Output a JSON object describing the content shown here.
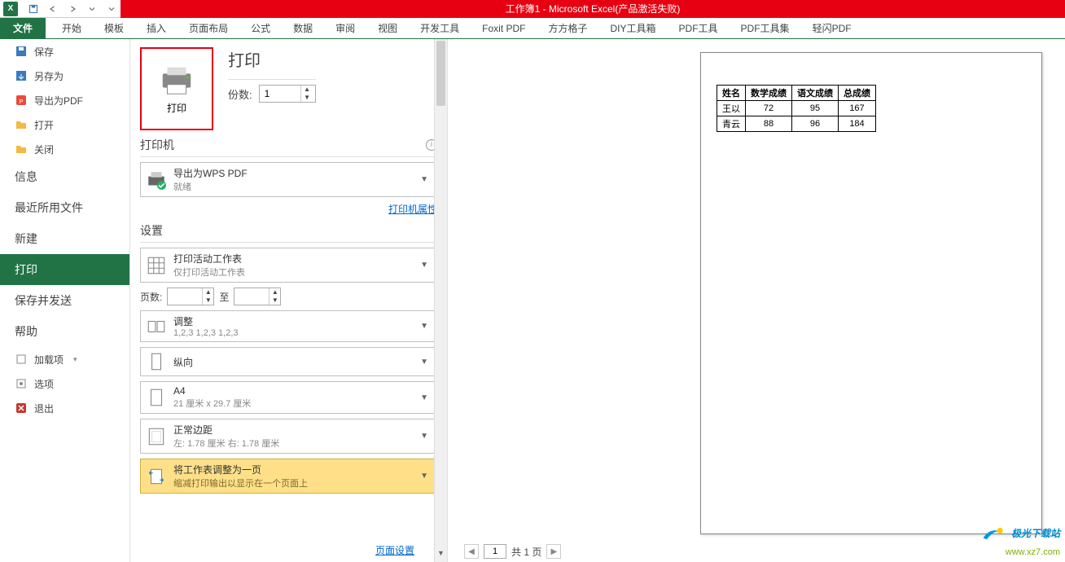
{
  "title": "工作簿1 - Microsoft Excel(产品激活失败)",
  "ribbon": {
    "file": "文件",
    "tabs": [
      "开始",
      "模板",
      "插入",
      "页面布局",
      "公式",
      "数据",
      "审阅",
      "视图",
      "开发工具",
      "Foxit PDF",
      "方方格子",
      "DIY工具箱",
      "PDF工具",
      "PDF工具集",
      "轻闪PDF"
    ]
  },
  "sidebar": {
    "save": "保存",
    "saveAs": "另存为",
    "exportPdf": "导出为PDF",
    "open": "打开",
    "close": "关闭",
    "info": "信息",
    "recent": "最近所用文件",
    "new": "新建",
    "print": "打印",
    "saveSend": "保存并发送",
    "help": "帮助",
    "addins": "加载项",
    "options": "选项",
    "exit": "退出"
  },
  "print": {
    "title": "打印",
    "printBtn": "打印",
    "copiesLabel": "份数:",
    "copiesValue": "1",
    "printerSection": "打印机",
    "printerName": "导出为WPS PDF",
    "printerStatus": "就绪",
    "printerProps": "打印机属性",
    "settingsSection": "设置",
    "whatTitle": "打印活动工作表",
    "whatSub": "仅打印活动工作表",
    "pagesLabel": "页数:",
    "toLabel": "至",
    "collateTitle": "调整",
    "collateSub": "1,2,3   1,2,3   1,2,3",
    "orientation": "纵向",
    "paperTitle": "A4",
    "paperSub": "21 厘米 x 29.7 厘米",
    "marginTitle": "正常边距",
    "marginSub": "左: 1.78 厘米   右: 1.78 厘米",
    "scaleTitle": "将工作表调整为一页",
    "scaleSub": "缩减打印输出以显示在一个页面上",
    "pageSetup": "页面设置"
  },
  "preview": {
    "pageCurrent": "1",
    "pageTotalLabel": "共 1 页",
    "table": {
      "headers": [
        "姓名",
        "数学成绩",
        "语文成绩",
        "总成绩"
      ],
      "rows": [
        [
          "王以",
          "72",
          "95",
          "167"
        ],
        [
          "青云",
          "88",
          "96",
          "184"
        ]
      ]
    }
  },
  "watermark": {
    "line1": "极光下载站",
    "line2": "www.xz7.com"
  }
}
